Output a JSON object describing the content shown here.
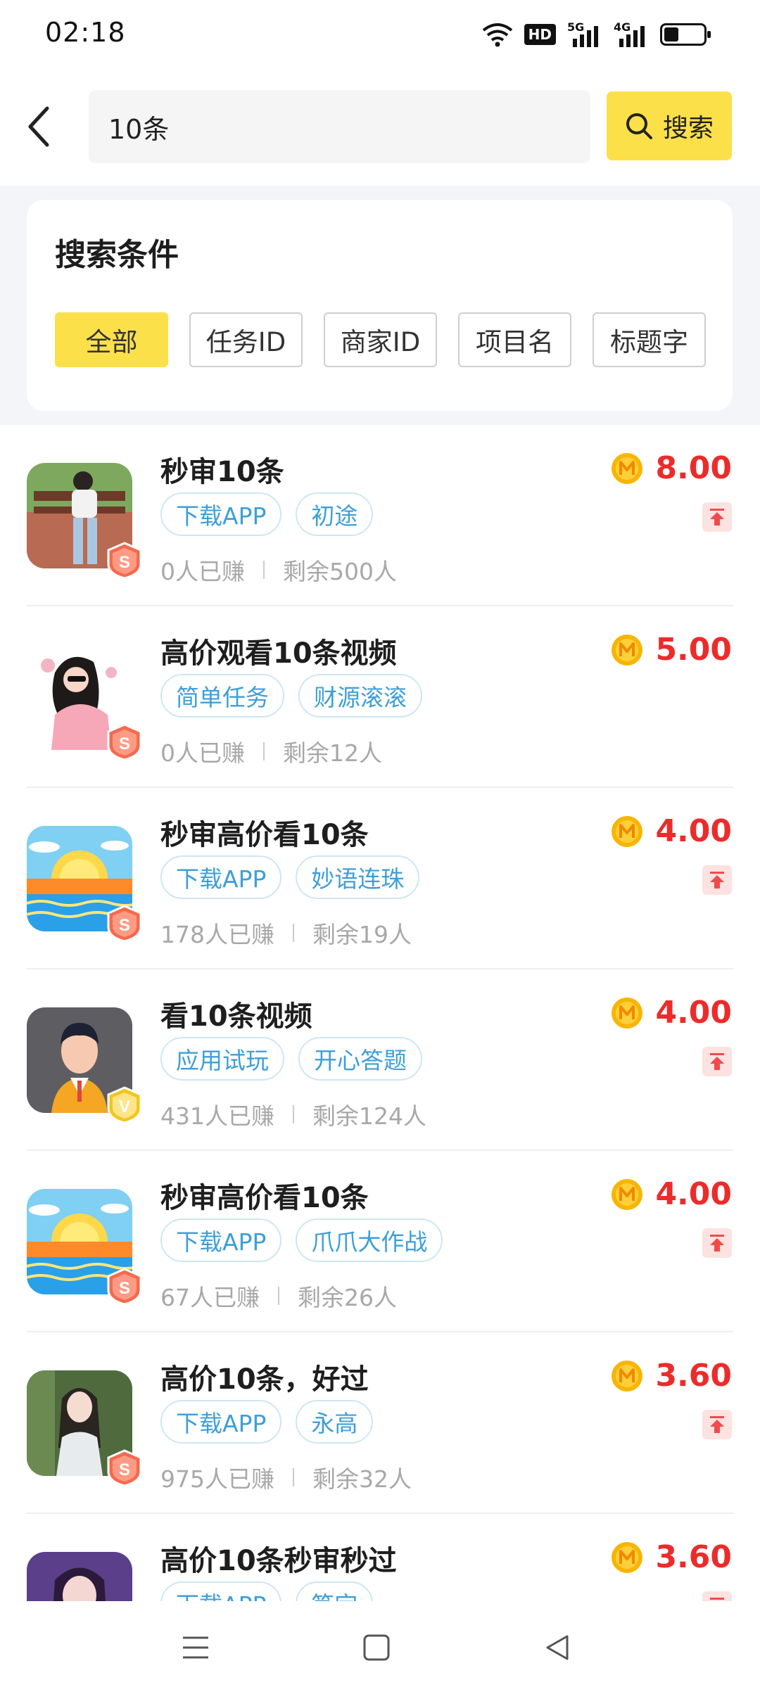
{
  "status_bar": {
    "time": "02:18",
    "icons": [
      "wifi-icon",
      "hd-icon",
      "5g-signal-icon",
      "4g-signal-icon",
      "battery-icon"
    ],
    "hd_label": "HD",
    "net1": "5G",
    "net2": "4G"
  },
  "search": {
    "query": "10条",
    "button_label": "搜索"
  },
  "filter": {
    "title": "搜索条件",
    "chips": [
      "全部",
      "任务ID",
      "商家ID",
      "项目名",
      "标题字"
    ],
    "active": "全部"
  },
  "colors": {
    "accent_yellow": "#fce04a",
    "price_red": "#ec2b2b",
    "tag_blue": "#3d9fd8"
  },
  "tasks": [
    {
      "title": "秒审10条",
      "tags": [
        "下载APP",
        "初途"
      ],
      "earned": "0人已赚",
      "remaining": "剩余500人",
      "price": "8.00",
      "badge": "S",
      "top_icon": true,
      "thumb": "photo-woman-bench"
    },
    {
      "title": "高价观看10条视频",
      "tags": [
        "简单任务",
        "财源滚滚"
      ],
      "earned": "0人已赚",
      "remaining": "剩余12人",
      "price": "5.00",
      "badge": "S",
      "top_icon": false,
      "thumb": "illustration-girl"
    },
    {
      "title": "秒审高价看10条",
      "tags": [
        "下载APP",
        "妙语连珠"
      ],
      "earned": "178人已赚",
      "remaining": "剩余19人",
      "price": "4.00",
      "badge": "S",
      "top_icon": true,
      "thumb": "sunset-sea"
    },
    {
      "title": "看10条视频",
      "tags": [
        "应用试玩",
        "开心答题"
      ],
      "earned": "431人已赚",
      "remaining": "剩余124人",
      "price": "4.00",
      "badge": "V",
      "top_icon": true,
      "thumb": "avatar-man"
    },
    {
      "title": "秒审高价看10条",
      "tags": [
        "下载APP",
        "爪爪大作战"
      ],
      "earned": "67人已赚",
      "remaining": "剩余26人",
      "price": "4.00",
      "badge": "S",
      "top_icon": true,
      "thumb": "sunset-sea"
    },
    {
      "title": "高价10条，好过",
      "tags": [
        "下载APP",
        "永高"
      ],
      "earned": "975人已赚",
      "remaining": "剩余32人",
      "price": "3.60",
      "badge": "S",
      "top_icon": true,
      "thumb": "photo-woman-garden"
    },
    {
      "title": "高价10条秒审秒过",
      "tags": [
        "下载APP",
        "笃定"
      ],
      "earned": "",
      "remaining": "",
      "price": "3.60",
      "badge": "",
      "top_icon": true,
      "thumb": "photo-woman-purple"
    }
  ]
}
